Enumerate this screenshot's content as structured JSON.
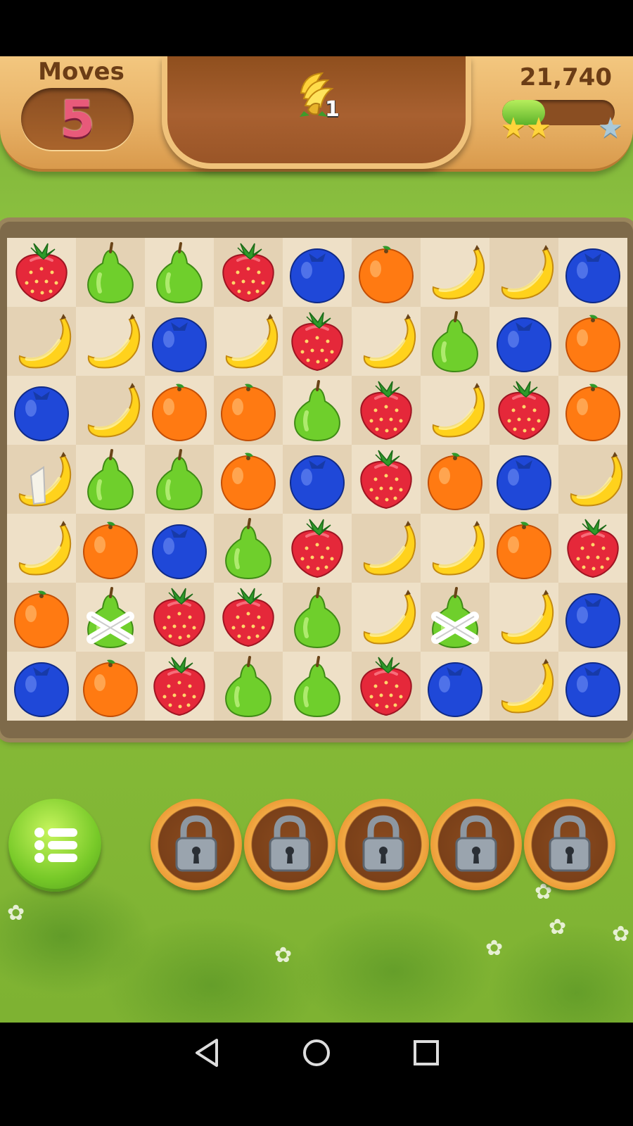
{
  "hud": {
    "moves_label": "Moves",
    "moves_value": "5",
    "goal": {
      "icon": "banana-bunch-icon",
      "count": "1"
    },
    "score": "21,740",
    "progress": 0.38,
    "stars_earned": 2,
    "stars_total": 3
  },
  "board": {
    "rows": 7,
    "cols": 9,
    "tiles": [
      [
        "strawberry",
        "pear",
        "pear",
        "strawberry",
        "blueberry",
        "orange",
        "banana",
        "banana",
        "blueberry"
      ],
      [
        "banana",
        "banana",
        "blueberry",
        "banana",
        "strawberry",
        "banana",
        "pear",
        "blueberry",
        "orange"
      ],
      [
        "blueberry",
        "banana",
        "orange",
        "orange",
        "pear",
        "strawberry",
        "banana",
        "strawberry",
        "orange"
      ],
      [
        "banana-wrapped",
        "pear",
        "pear",
        "orange",
        "blueberry",
        "strawberry",
        "orange",
        "blueberry",
        "banana"
      ],
      [
        "banana",
        "orange",
        "blueberry",
        "pear",
        "strawberry",
        "banana",
        "banana",
        "orange",
        "strawberry"
      ],
      [
        "orange",
        "pear-wrapped",
        "strawberry",
        "strawberry",
        "pear",
        "banana",
        "pear-wrapped",
        "banana",
        "blueberry"
      ],
      [
        "blueberry",
        "orange",
        "strawberry",
        "pear",
        "pear",
        "strawberry",
        "blueberry",
        "banana",
        "blueberry"
      ]
    ]
  },
  "boosters": [
    {
      "icon": "padlock-icon",
      "locked": true
    },
    {
      "icon": "padlock-icon",
      "locked": true
    },
    {
      "icon": "padlock-icon",
      "locked": true
    },
    {
      "icon": "padlock-icon",
      "locked": true
    },
    {
      "icon": "padlock-icon",
      "locked": true
    }
  ],
  "menu_button": {
    "icon": "menu-list-icon"
  },
  "nav": [
    {
      "icon": "back-triangle-icon"
    },
    {
      "icon": "home-circle-icon"
    },
    {
      "icon": "recents-square-icon"
    }
  ],
  "colors": {
    "grass": "#8cc13f",
    "wood_light": "#f3c77f",
    "wood_dark": "#9a5527",
    "star_gold": "#ffd43b",
    "progress_green": "#5cb22a"
  }
}
